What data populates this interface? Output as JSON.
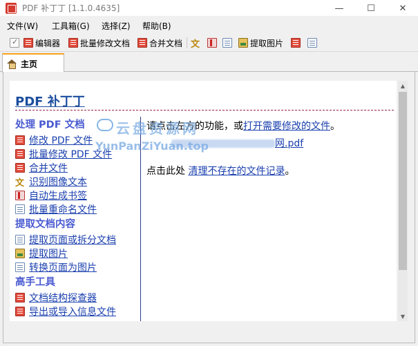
{
  "window": {
    "title": "PDF 补丁丁 [1.1.0.4635]",
    "min_glyph": "—",
    "max_glyph": "☐",
    "close_glyph": "✕"
  },
  "menu": [
    "文件(W)",
    "工具箱(G)",
    "选择(Z)",
    "帮助(B)"
  ],
  "toolbar": {
    "editor": "编辑器",
    "batch_modify": "批量修改文档",
    "merge": "合并文档",
    "extract_images": "提取图片"
  },
  "tab": {
    "label": "主页"
  },
  "page": {
    "title": "PDF 补丁丁",
    "sections": [
      {
        "title": "处理 PDF 文档",
        "links": [
          "修改 PDF 文件",
          "批量修改 PDF 文件",
          "合并文件",
          "识别图像文本",
          "自动生成书签",
          "批量重命名文件"
        ]
      },
      {
        "title": "提取文档内容",
        "links": [
          "提取页面或拆分文档",
          "提取图片",
          "转换页面为图片"
        ]
      },
      {
        "title": "高手工具",
        "links": [
          "文档结构探查器",
          "导出或导入信息文件"
        ]
      }
    ],
    "right": {
      "prompt_prefix": "请点击左方的功能，或",
      "prompt_link": "打开需要修改的文件",
      "prompt_suffix": "。",
      "recent_file_suffix": "网.pdf",
      "clear_prefix": "点击此处 ",
      "clear_link": "清理不存在的文件记录",
      "clear_suffix": "。"
    },
    "watermark": {
      "main": "云盘资源网",
      "sub": "YunPanZiYuan.top"
    }
  },
  "colors": {
    "link": "#1a3fae",
    "title": "#1b4d9e",
    "section": "#4a5bd1",
    "tab_accent": "#f7a21b"
  }
}
